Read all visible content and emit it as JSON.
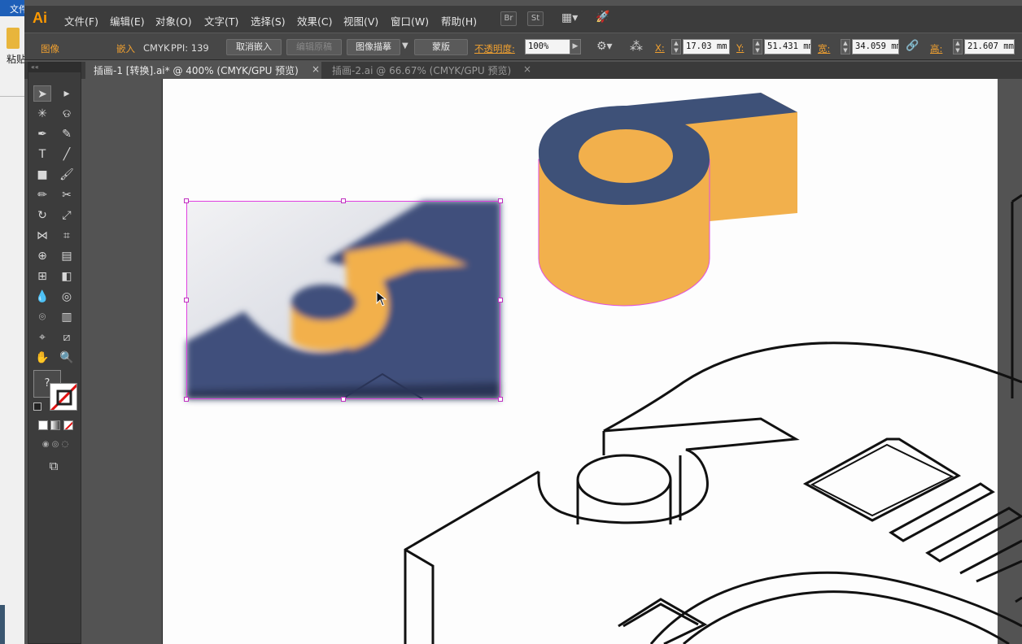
{
  "sliver": {
    "tab_text": "文件",
    "label": "粘贴"
  },
  "app": {
    "logo": "Ai"
  },
  "menu": [
    "文件(F)",
    "编辑(E)",
    "对象(O)",
    "文字(T)",
    "选择(S)",
    "效果(C)",
    "视图(V)",
    "窗口(W)",
    "帮助(H)"
  ],
  "menu_icons": {
    "bridge": "Br",
    "stock": "St"
  },
  "control": {
    "object_type": "图像",
    "embed_label": "嵌入",
    "color_mode": "CMYK",
    "ppi": "PPI: 139",
    "unembed": "取消嵌入",
    "edit_original": "编辑原稿",
    "image_trace": "图像描摹",
    "mask": "蒙版",
    "opacity_label": "不透明度:",
    "opacity_value": "100%",
    "x_label": "X:",
    "x_value": "17.03 mm",
    "y_label": "Y:",
    "y_value": "51.431 mm",
    "w_label": "宽:",
    "w_value": "34.059 mm",
    "h_label": "高:",
    "h_value": "21.607 mm"
  },
  "tabs": [
    {
      "label": "插画-1 [转换].ai* @ 400% (CMYK/GPU 预览)",
      "close": "×"
    },
    {
      "label": "插画-2.ai @ 66.67% (CMYK/GPU 预览)",
      "close": "×"
    }
  ],
  "toolbox": {
    "collapse": "««",
    "type_tool": "T",
    "unknown_swatch": "?"
  },
  "colors": {
    "brand": "#ff9a00",
    "navy": "#3e5178",
    "orange": "#f2b04c",
    "selection": "#e040e0"
  }
}
